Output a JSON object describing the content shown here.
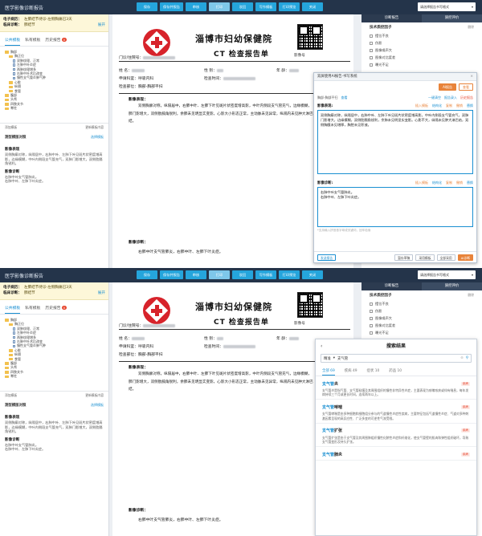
{
  "app_title": "医学影像诊断报告",
  "toolbar": [
    {
      "label": "保存",
      "disabled": false
    },
    {
      "label": "保存并报告",
      "disabled": false
    },
    {
      "label": "审核",
      "disabled": false
    },
    {
      "label": "打印",
      "disabled": true
    },
    {
      "label": "驳回",
      "disabled": false
    },
    {
      "label": "写作模板",
      "disabled": false
    },
    {
      "label": "打印预览",
      "disabled": false
    },
    {
      "label": "关闭",
      "disabled": false
    }
  ],
  "report_mode": "请选择报告书写格式",
  "patient": {
    "label1": "电子病历：",
    "value1": "左肺结节待诊-左侧胸痛已3天",
    "label2": "临床诊断：",
    "value2": "肺结节",
    "more": "展开"
  },
  "left_tabs": [
    {
      "label": "公共模板",
      "active": true,
      "badge": ""
    },
    {
      "label": "私有模板",
      "active": false,
      "badge": ""
    },
    {
      "label": "历史报告",
      "active": false,
      "badge": "0"
    }
  ],
  "tree": [
    {
      "text": "胸部",
      "depth": 0,
      "type": "folder"
    },
    {
      "text": "胸正位",
      "depth": 1,
      "type": "folder"
    },
    {
      "text": "双肺纹理、正常",
      "depth": 2,
      "type": "doc"
    },
    {
      "text": "左肺中叶炎症",
      "depth": 2,
      "type": "doc"
    },
    {
      "text": "两肺纹理增多",
      "depth": 2,
      "type": "doc"
    },
    {
      "text": "右肺中叶术后改变",
      "depth": 2,
      "type": "doc"
    },
    {
      "text": "慢性支气管炎肺气肿",
      "depth": 2,
      "type": "doc"
    },
    {
      "text": "心脏",
      "depth": 1,
      "type": "folder"
    },
    {
      "text": "纵隔",
      "depth": 1,
      "type": "folder"
    },
    {
      "text": "食管",
      "depth": 1,
      "type": "folder"
    },
    {
      "text": "腹部",
      "depth": 0,
      "type": "folder"
    },
    {
      "text": "头颅",
      "depth": 0,
      "type": "folder"
    },
    {
      "text": "四肢关节",
      "depth": 0,
      "type": "folder"
    },
    {
      "text": "脊柱",
      "depth": 0,
      "type": "folder"
    }
  ],
  "tree_actions": {
    "left": "添加模板",
    "right": "更新模板内容"
  },
  "left_section": {
    "title": "测型模版对照",
    "link": "选择模板"
  },
  "left_findings_title": "影像表现",
  "left_findings": "双侧胸廓对称，纵隔居中，右肺中叶、左肺下叶见斑片状密度增高影，边缘模糊，中叶内侧段支气管充气，双肺门影增大，双侧肋膈角锐利。",
  "left_diag_title": "影像诊断",
  "left_diag": [
    "右肺中叶支气管肺炎。",
    "右肺中叶、左肺下叶炎症。"
  ],
  "report": {
    "hospital": "淄博市妇幼保健院",
    "title": "CT 检查报告单",
    "qr_caption": "影像号",
    "outpatient_label": "门诊/住院号：",
    "image_no_label": "影 像 号：",
    "name_label": "姓      名：",
    "gender_label": "性      别：",
    "age_label": "年      龄：",
    "dept_label": "申请科室：",
    "dept_value": "呼吸内科",
    "check_date_label": "检查时间：",
    "part_label": "检查部位：",
    "part_value": "胸部-胸部平扫",
    "findings_title": "影像表现：",
    "findings": "双侧胸廓对称，纵隔居中，右肺中叶、左肺下叶见斑片状密度增高影，中叶内侧段支气管充气，边缘模糊，肺门影增大，双侧肋膈角锐利，余肺未见明显实变影，心影大小形态正常，主动脉未见异常，纵隔内未见肿大淋巴结。",
    "diag_title": "影像诊断：",
    "diag": "右肺中叶支气管肺炎，右肺中叶、左肺下叶炎症。"
  },
  "right_tabs": [
    {
      "label": "诊断报告",
      "active": true
    },
    {
      "label": "质控评价",
      "active": false
    }
  ],
  "right_panel": {
    "heading": "技术质控因子",
    "delete": "删除",
    "items": [
      "摆位不良",
      "伪影",
      "图像噪声大",
      "图像对比度差",
      "曝光不足"
    ]
  },
  "editor": {
    "title": "双屏使用AI报告·书写系统",
    "close": "×",
    "btn_primary": "AI报告",
    "btn_ghost": "查看",
    "row2": [
      "胸部-胸部平扫",
      "查看",
      "一键清空",
      "报告录入",
      "历史报告"
    ],
    "findings_label": "影像表现:",
    "findings_actions": [
      "插入模板",
      "结构化",
      "复制",
      "撤销",
      "替换"
    ],
    "findings_text": "双侧胸廓对称，纵隔居中，右肺中叶、左肺下叶见斑片状密度增高影，中叶内侧段支气管充气，双肺门影增大，边缘模糊，双侧肋膈角锐利，余肺未见明显实变影。心影不大，纵隔未见肿大淋巴结，双侧胸膜未见增厚，胸腔未见积液。",
    "diag_label": "影像诊断:",
    "diag_actions": [
      "插入模板",
      "结构化",
      "复制",
      "撤销",
      "替换"
    ],
    "diag_text": [
      "右肺中叶支气管肺炎。",
      "右肺中叶、左肺下叶炎症。"
    ],
    "hint": "*支持输入拼音首字母或关键词，回车检索",
    "footer": [
      "发送报告",
      "暂存草稿",
      "采用模板",
      "全部采用",
      "AI诊断"
    ]
  },
  "search": {
    "title": "搜索结果",
    "back": "‹",
    "mode": "精准",
    "query": "支气管",
    "tabs": [
      {
        "label": "全部 69",
        "active": true
      },
      {
        "label": "疾病 49",
        "active": false
      },
      {
        "label": "症状 10",
        "active": false
      },
      {
        "label": "药品 10",
        "active": false
      }
    ],
    "results": [
      {
        "title": "支气管炎",
        "hl": "支气管",
        "rest": "炎",
        "tag": "疾病",
        "desc": "支气管炎是指气管、支气管粘膜及其周围组织的慢性非特异性炎症，主要表现为咳嗽咳痰或伴有喘息，每年发病持续三个月或更长时间，连续两年以上。"
      },
      {
        "title": "支气管哮喘",
        "hl": "支气管",
        "rest": "哮喘",
        "tag": "疾病",
        "desc": "支气管哮喘是由多种细胞和细胞组分参与的气道慢性炎症性疾病，主要特征包括气道慢性炎症、气道对多种刺激因素呈现的高反应性、广泛多变的可逆性气流受限。"
      },
      {
        "title": "支气管扩张",
        "hl": "支气管",
        "rest": "扩张",
        "tag": "疾病",
        "desc": "支气管扩张是由于支气管及其周围肺组织慢性化脓性炎症和纤维化，使支气管壁的肌肉和弹性组织破坏，导致支气管变形及持久扩张。"
      },
      {
        "title": "支气管肺炎",
        "hl": "支气管",
        "rest": "肺炎",
        "tag": "疾病",
        "desc": ""
      }
    ]
  }
}
